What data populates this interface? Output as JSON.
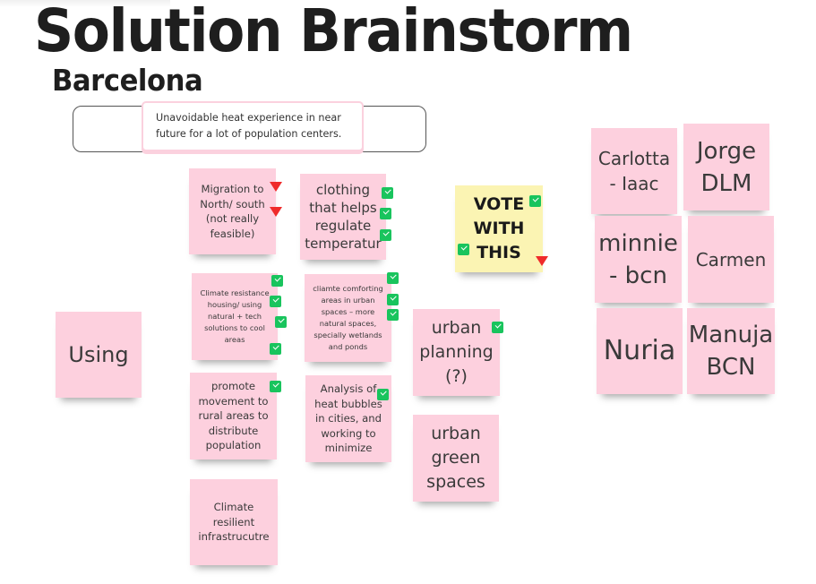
{
  "board": {
    "title": "Solution Brainstorm",
    "subtitle": "Barcelona",
    "problem_statement": "Unavoidable heat experience in near future for a lot of population centers."
  },
  "stickies": {
    "using": "Using",
    "migration": "Migration to\nNorth/ south\n(not really\nfeasible)",
    "clothing": "clothing\nthat helps\nregulate\ntemperatur",
    "housing": "Climate resistance\nhousing/ using\nnatural + tech\nsolutions to cool\nareas",
    "comfort_areas": "cliamte comforting\nareas in urban\nspaces – more\nnatural spaces,\nspecially wetlands\nand ponds",
    "rural": "promote\nmovement to\nrural areas to\ndistribute\npopulation",
    "heat_bubbles": "Analysis of\nheat bubbles\nin cities, and\nworking to\nminimize",
    "infrastructure": "Climate\nresilient\ninfrastrucutre",
    "vote": "VOTE\nWITH\nTHIS",
    "urban_planning": "urban\nplanning\n(?)",
    "urban_green": "urban\ngreen\nspaces"
  },
  "participants": [
    "Carlotta\n- Iaac",
    "Jorge\nDLM",
    "minnie\n- bcn",
    "Carmen",
    "Nuria",
    "Manuja\nBCN"
  ],
  "votes": {
    "migration": {
      "likes": 0,
      "dislikes": 2
    },
    "clothing": {
      "likes": 3,
      "dislikes": 0
    },
    "housing": {
      "likes": 4,
      "dislikes": 0
    },
    "comfort_areas": {
      "likes": 3,
      "dislikes": 0
    },
    "rural": {
      "likes": 1,
      "dislikes": 0
    },
    "heat_bubbles": {
      "likes": 1,
      "dislikes": 0
    },
    "urban_planning": {
      "likes": 1,
      "dislikes": 0
    },
    "vote": {
      "likes": 2,
      "dislikes": 1
    }
  },
  "colors": {
    "sticky_pink": "#fdd0de",
    "sticky_yellow": "#fbf4b3",
    "like_green": "#19c45d",
    "dislike_red": "#ef2b2b"
  }
}
